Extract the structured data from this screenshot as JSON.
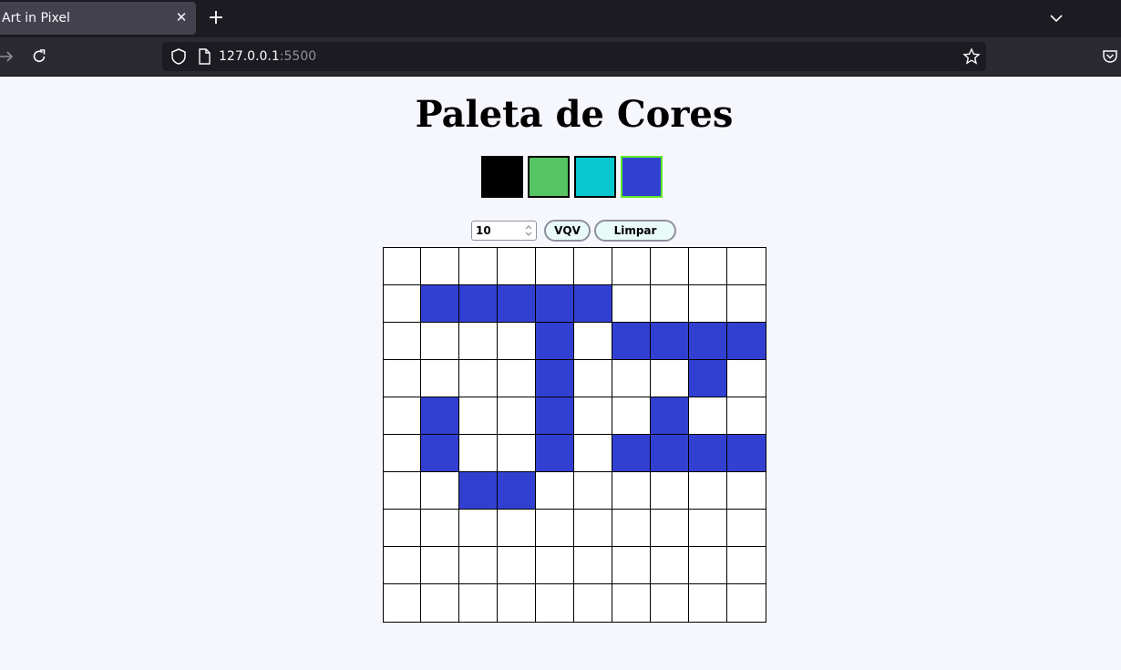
{
  "browser": {
    "tab_title": "Art in Pixel",
    "tab_close_icon": "close-icon",
    "new_tab_icon": "plus-icon",
    "url_host": "127.0.0.1",
    "url_port": ":5500"
  },
  "page": {
    "title": "Paleta de Cores",
    "palette": [
      {
        "color": "#000000",
        "selected": false
      },
      {
        "color": "#56c463",
        "selected": false
      },
      {
        "color": "#0ac6cf",
        "selected": false
      },
      {
        "color": "#3240d2",
        "selected": true
      }
    ],
    "board_size_input": "10",
    "vqv_label": "VQV",
    "clear_label": "Limpar",
    "board": {
      "rows": 10,
      "cols": 10,
      "empty_color": "#ffffff",
      "fill_color": "#3240d2",
      "cells": [
        [
          0,
          0,
          0,
          0,
          0,
          0,
          0,
          0,
          0,
          0
        ],
        [
          0,
          1,
          1,
          1,
          1,
          1,
          0,
          0,
          0,
          0
        ],
        [
          0,
          0,
          0,
          0,
          1,
          0,
          1,
          1,
          1,
          1
        ],
        [
          0,
          0,
          0,
          0,
          1,
          0,
          0,
          0,
          1,
          0
        ],
        [
          0,
          1,
          0,
          0,
          1,
          0,
          0,
          1,
          0,
          0
        ],
        [
          0,
          1,
          0,
          0,
          1,
          0,
          1,
          1,
          1,
          1
        ],
        [
          0,
          0,
          1,
          1,
          0,
          0,
          0,
          0,
          0,
          0
        ],
        [
          0,
          0,
          0,
          0,
          0,
          0,
          0,
          0,
          0,
          0
        ],
        [
          0,
          0,
          0,
          0,
          0,
          0,
          0,
          0,
          0,
          0
        ],
        [
          0,
          0,
          0,
          0,
          0,
          0,
          0,
          0,
          0,
          0
        ]
      ]
    }
  }
}
